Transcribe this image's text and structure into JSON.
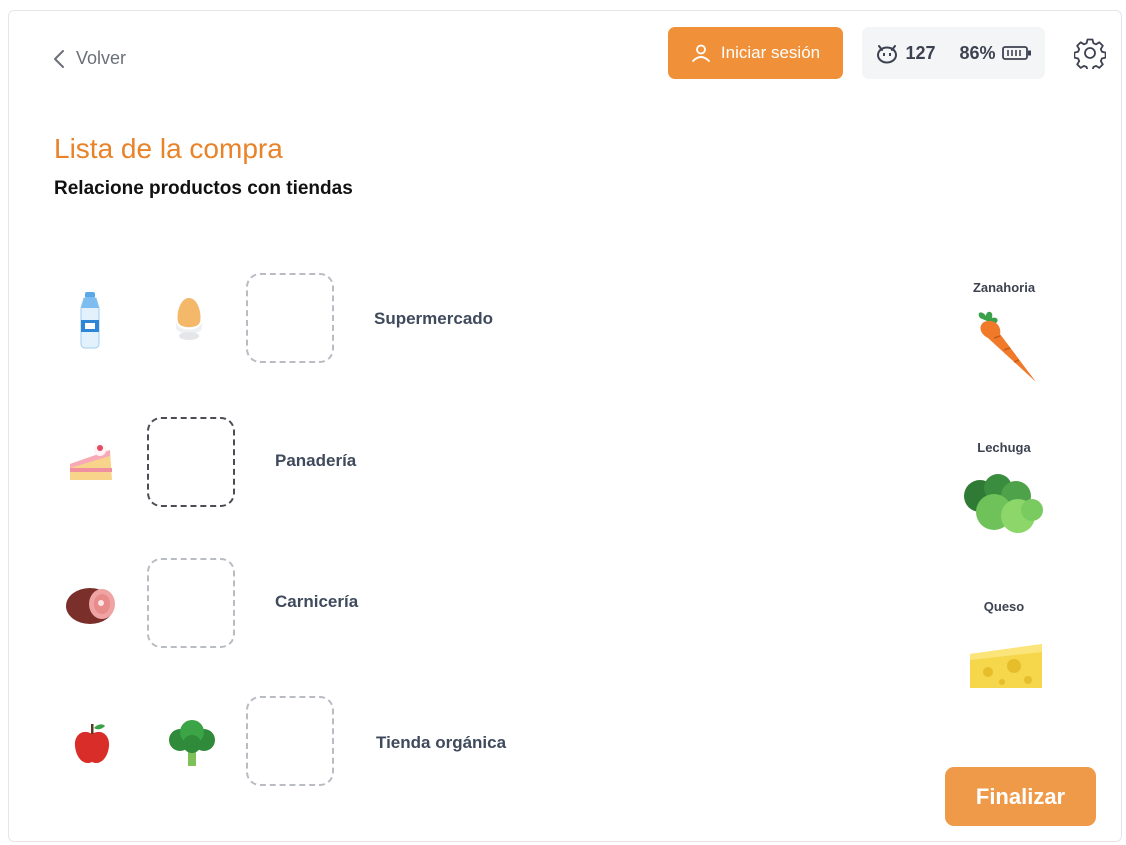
{
  "header": {
    "back_label": "Volver",
    "login_label": "Iniciar sesión",
    "coins": "127",
    "battery": "86%"
  },
  "page": {
    "title": "Lista de la compra",
    "subtitle": "Relacione productos con tiendas"
  },
  "stores": [
    {
      "label": "Supermercado",
      "items": [
        "water-bottle-icon",
        "egg-icon"
      ]
    },
    {
      "label": "Panadería",
      "items": [
        "cake-slice-icon"
      ]
    },
    {
      "label": "Carnicería",
      "items": [
        "ham-icon"
      ]
    },
    {
      "label": "Tienda orgánica",
      "items": [
        "apple-icon",
        "broccoli-icon"
      ]
    }
  ],
  "products": [
    {
      "label": "Zanahoria",
      "icon": "carrot-icon"
    },
    {
      "label": "Lechuga",
      "icon": "lettuce-icon"
    },
    {
      "label": "Queso",
      "icon": "cheese-icon"
    }
  ],
  "finish_label": "Finalizar",
  "colors": {
    "accent": "#f0913a",
    "title": "#e8832a",
    "finish": "#ef9a48"
  }
}
